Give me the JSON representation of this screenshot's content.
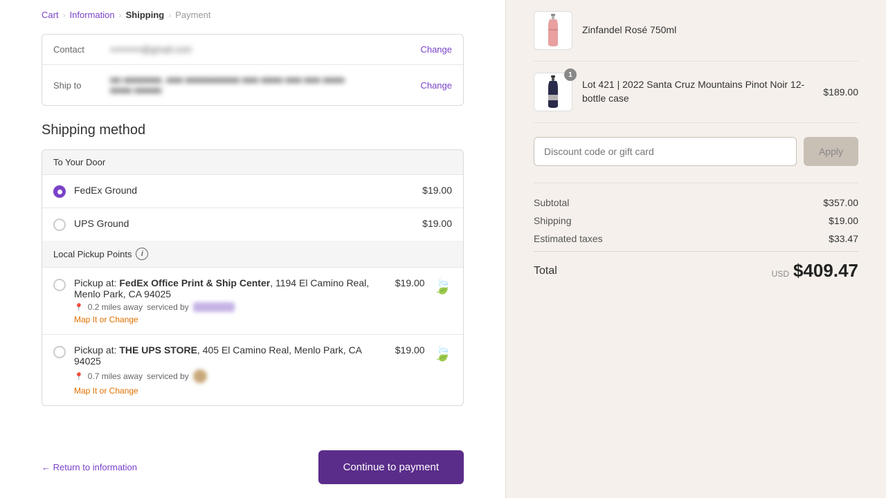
{
  "breadcrumb": {
    "items": [
      {
        "label": "Cart",
        "type": "link"
      },
      {
        "label": "Information",
        "type": "link"
      },
      {
        "label": "Shipping",
        "type": "active"
      },
      {
        "label": "Payment",
        "type": "normal"
      }
    ],
    "separators": [
      "›",
      "›",
      "›"
    ]
  },
  "contact": {
    "label": "Contact",
    "value": "redacted@gmail.com",
    "change": "Change"
  },
  "ship_to": {
    "label": "Ship to",
    "value": "123 Redacted Ave, Menlo Park, CA 94025",
    "change": "Change"
  },
  "shipping_method": {
    "title": "Shipping method",
    "groups": [
      {
        "label": "To Your Door",
        "options": [
          {
            "id": "fedex-ground",
            "name": "FedEx Ground",
            "price": "$19.00",
            "selected": true
          },
          {
            "id": "ups-ground",
            "name": "UPS Ground",
            "price": "$19.00",
            "selected": false
          }
        ]
      },
      {
        "label": "Local Pickup Points",
        "show_info": true,
        "options": [
          {
            "id": "fedex-pickup",
            "name_prefix": "Pickup at: ",
            "name_bold": "FedEx Office Print & Ship Center",
            "name_suffix": ", 1194 El Camino Real, Menlo Park, CA 94025",
            "distance": "0.2 miles away",
            "serviced_by": "serviced by",
            "service_color": "purple",
            "price": "$19.00",
            "selected": false,
            "map_link": "Map It or Change"
          },
          {
            "id": "ups-pickup",
            "name_prefix": "Pickup at: ",
            "name_bold": "THE UPS STORE",
            "name_suffix": ", 405 El Camino Real, Menlo Park, CA 94025",
            "distance": "0.7 miles away",
            "serviced_by": "serviced by",
            "service_color": "brown",
            "price": "$19.00",
            "selected": false,
            "map_link": "Map It or Change"
          }
        ]
      }
    ]
  },
  "footer": {
    "return_label": "← Return to information",
    "continue_label": "Continue to payment"
  },
  "order": {
    "items": [
      {
        "name": "Zinfandel Rosé 750ml",
        "price": "",
        "badge": null,
        "img_type": "rose"
      },
      {
        "name": "Lot 421 | 2022 Santa Cruz Mountains Pinot Noir 12-bottle case",
        "price": "$189.00",
        "badge": "1",
        "img_type": "pinot"
      }
    ]
  },
  "discount": {
    "placeholder": "Discount code or gift card",
    "apply_label": "Apply"
  },
  "totals": {
    "subtotal_label": "Subtotal",
    "subtotal_value": "$357.00",
    "shipping_label": "Shipping",
    "shipping_value": "$19.00",
    "taxes_label": "Estimated taxes",
    "taxes_value": "$33.47",
    "total_label": "Total",
    "total_currency": "USD",
    "total_value": "$409.47"
  }
}
